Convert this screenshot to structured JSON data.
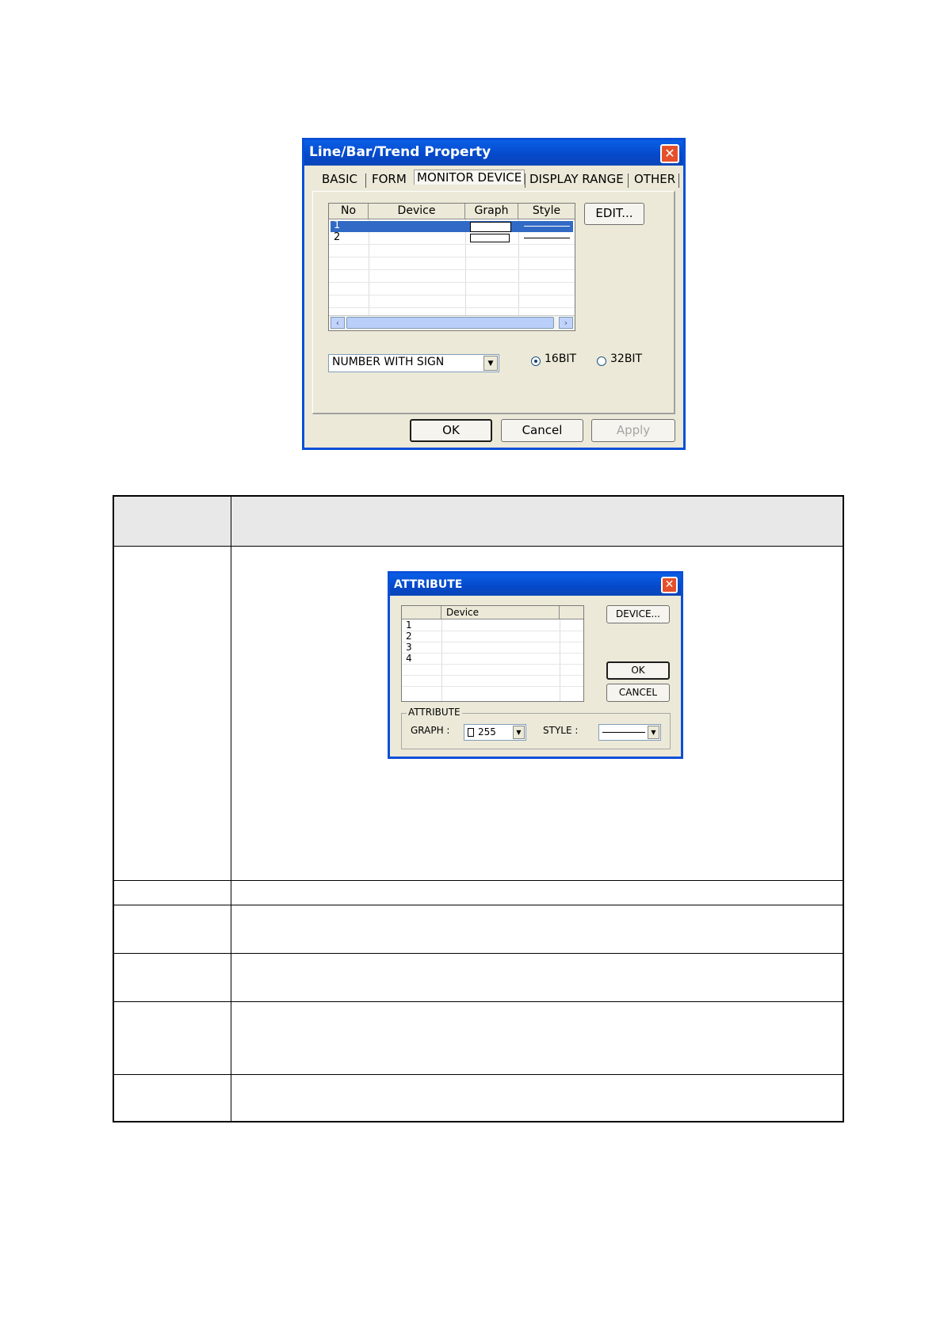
{
  "property_dialog": {
    "title": "Line/Bar/Trend Property",
    "tabs": [
      {
        "label": "BASIC",
        "active": false
      },
      {
        "label": "FORM",
        "active": false
      },
      {
        "label": "MONITOR DEVICE",
        "active": true
      },
      {
        "label": "DISPLAY RANGE",
        "active": false
      },
      {
        "label": "OTHER",
        "active": false
      }
    ],
    "grid": {
      "columns": [
        "No",
        "Device",
        "Graph",
        "Style"
      ],
      "rows": [
        {
          "no": "1",
          "device": "",
          "selected": true
        },
        {
          "no": "2",
          "device": "",
          "selected": false
        }
      ]
    },
    "edit_button": "EDIT...",
    "number_format": "NUMBER WITH SIGN",
    "bit_options": [
      {
        "label": "16BIT",
        "selected": true
      },
      {
        "label": "32BIT",
        "selected": false
      }
    ],
    "ok_button": "OK",
    "cancel_button": "Cancel",
    "apply_button": "Apply"
  },
  "attribute_dialog": {
    "title": "ATTRIBUTE",
    "grid": {
      "columns": [
        "",
        "Device",
        ""
      ],
      "rows": [
        "1",
        "2",
        "3",
        "4"
      ]
    },
    "device_button": "DEVICE...",
    "ok_button": "OK",
    "cancel_button": "CANCEL",
    "group_label": "ATTRIBUTE",
    "graph_label": "GRAPH :",
    "graph_value": "255",
    "style_label": "STYLE :"
  },
  "colors": {
    "title_bar": "#0548c9",
    "dialog_face": "#ece9d8",
    "selection": "#316ac5",
    "close_button": "#e5502b"
  }
}
